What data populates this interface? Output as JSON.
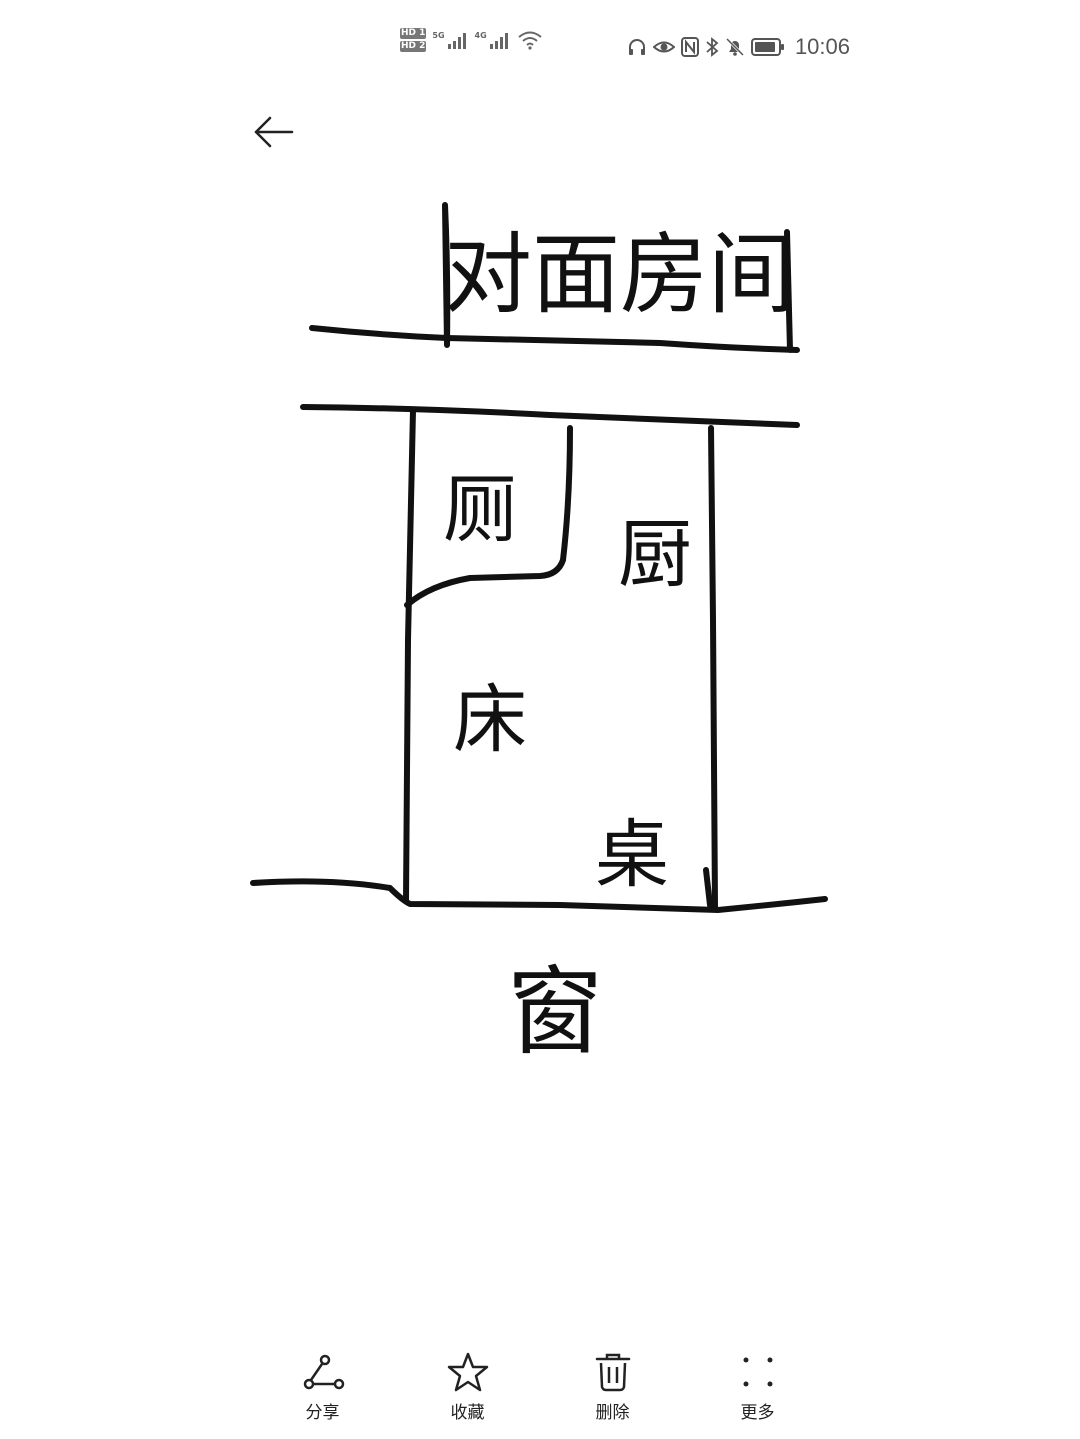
{
  "status_bar": {
    "sim1_label": "HD 1",
    "sim2_label": "HD 2",
    "network1": "5G",
    "network2": "4G",
    "time": "10:06",
    "icons": [
      "headphones-icon",
      "eye-icon",
      "nfc-icon",
      "bluetooth-icon",
      "mute-icon",
      "battery-icon"
    ]
  },
  "toolbar": {
    "back_icon": "arrow-left-icon"
  },
  "drawing": {
    "label_top": "对面房间",
    "label_toilet": "厕",
    "label_kitchen": "厨",
    "label_bed": "床",
    "label_desk": "桌",
    "label_window": "窗"
  },
  "bottom_bar": {
    "items": [
      {
        "label": "分享",
        "icon": "share-icon"
      },
      {
        "label": "收藏",
        "icon": "star-icon"
      },
      {
        "label": "删除",
        "icon": "trash-icon"
      },
      {
        "label": "更多",
        "icon": "more-icon"
      }
    ]
  },
  "colors": {
    "background": "#ffffff",
    "ink": "#111111",
    "status_text": "#555555"
  }
}
